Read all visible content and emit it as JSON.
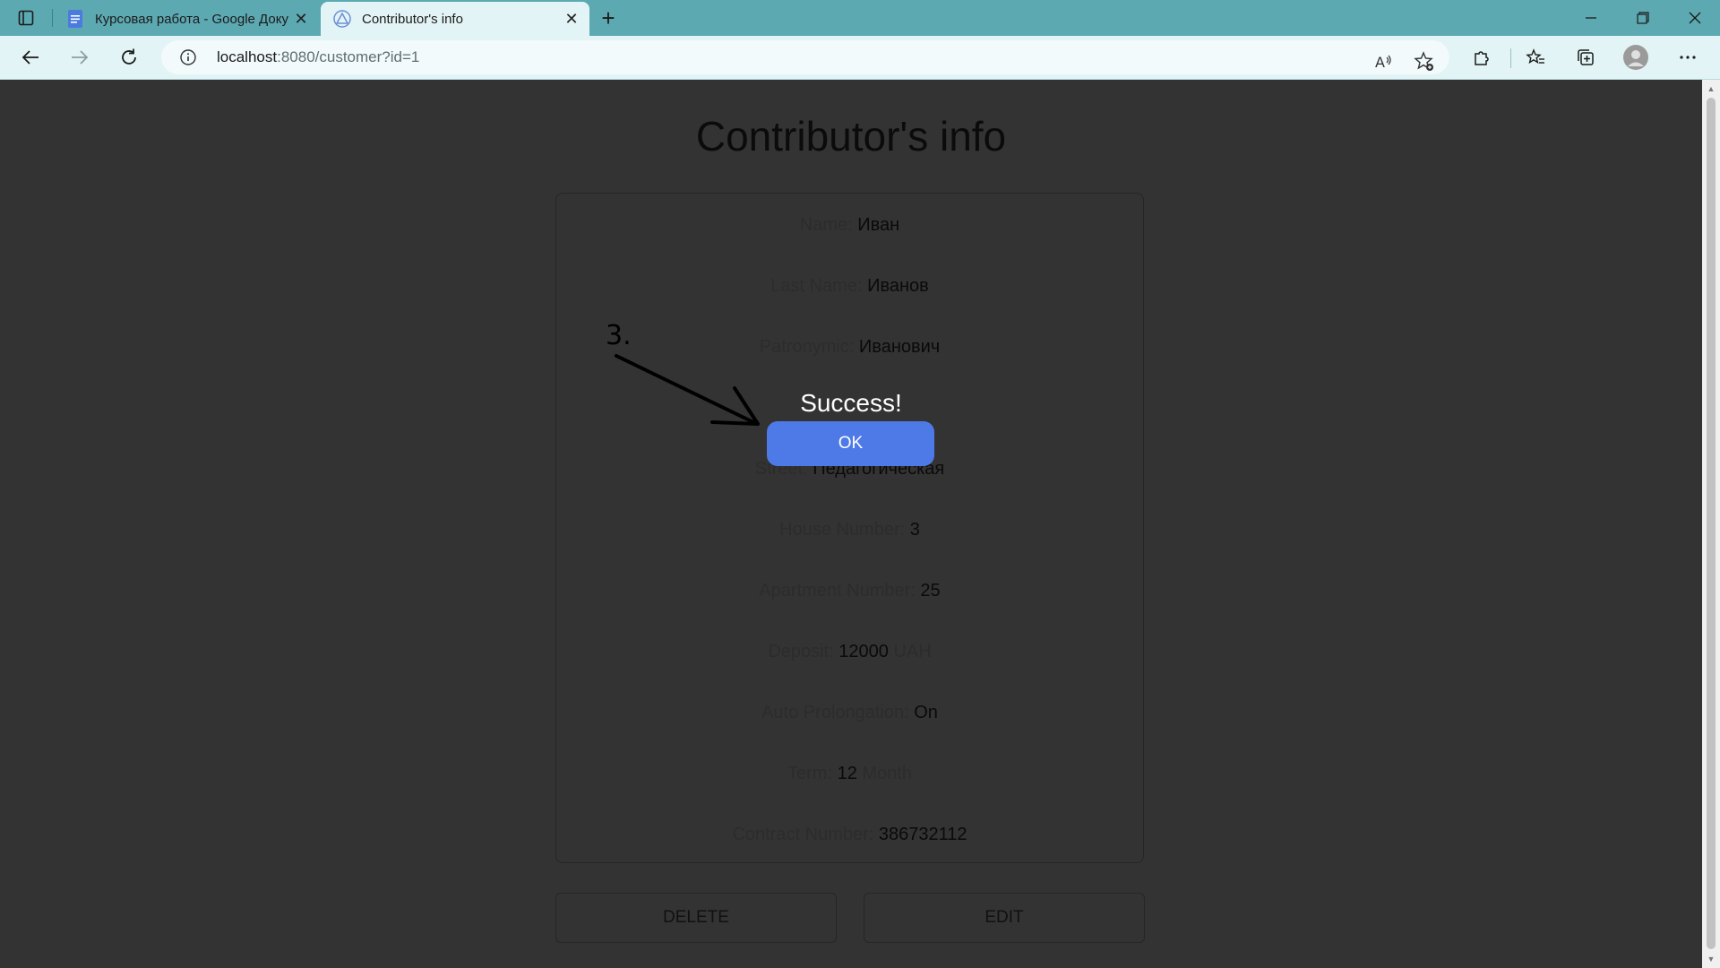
{
  "browser": {
    "tabs": [
      {
        "title": "Курсовая работа - Google Доку",
        "favicon": "google-docs-icon",
        "active": false
      },
      {
        "title": "Contributor's info",
        "favicon": "app-triangle-icon",
        "active": true
      }
    ],
    "url_host": "localhost",
    "url_rest": ":8080/customer?id=1"
  },
  "page": {
    "title": "Contributor's info",
    "fields": [
      {
        "label": "Name:",
        "value": "Иван",
        "unit": ""
      },
      {
        "label": "Last Name:",
        "value": "Иванов",
        "unit": ""
      },
      {
        "label": "Patronymic:",
        "value": "Иванович",
        "unit": ""
      },
      {
        "label": "",
        "value": "",
        "unit": ""
      },
      {
        "label": "Street:",
        "value": "Педагогическая",
        "unit": ""
      },
      {
        "label": "House Number:",
        "value": "3",
        "unit": ""
      },
      {
        "label": "Apartment Number:",
        "value": "25",
        "unit": ""
      },
      {
        "label": "Deposit:",
        "value": "12000",
        "unit": "UAH"
      },
      {
        "label": "Auto Prolongation:",
        "value": "On",
        "unit": ""
      },
      {
        "label": "Term:",
        "value": "12",
        "unit": "Month"
      },
      {
        "label": "Contract Number:",
        "value": "386732112",
        "unit": ""
      }
    ],
    "delete_label": "DELETE",
    "edit_label": "EDIT"
  },
  "dialog": {
    "title": "Success!",
    "ok_label": "OK"
  },
  "annotation": {
    "number": "3."
  },
  "colors": {
    "tabbar": "#5ca9b2",
    "toolbar": "#e3f4f6",
    "overlay_background": "#333333",
    "ok_button": "#4e7ae8"
  }
}
